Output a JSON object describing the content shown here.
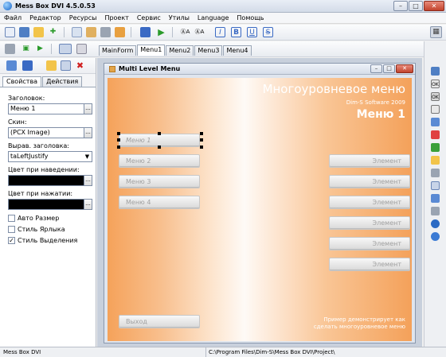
{
  "window": {
    "title": "Mess Box DVI 4.5.0.53"
  },
  "menu": [
    "Файл",
    "Редактор",
    "Ресурсы",
    "Проект",
    "Сервис",
    "Утилы",
    "Language",
    "Помощь"
  ],
  "doc_tabs": [
    "MainForm",
    "Menu1",
    "Menu2",
    "Menu3",
    "Menu4"
  ],
  "active_tab": "Menu1",
  "inspector": {
    "tabs": [
      "Свойства",
      "Действия"
    ],
    "caption_label": "Заголовок:",
    "caption_value": "Меню 1",
    "skin_label": "Скин:",
    "skin_value": "(PCX Image)",
    "align_label": "Вырав. заголовка:",
    "align_value": "taLeftJustify",
    "hover_color_label": "Цвет при наведении:",
    "press_color_label": "Цвет при нажатии:",
    "dots": "...",
    "checkboxes": [
      {
        "label": "Авто Размер",
        "checked": false
      },
      {
        "label": "Стиль Ярлыка",
        "checked": false
      },
      {
        "label": "Стиль Выделения",
        "checked": true
      }
    ]
  },
  "form_window": {
    "title": "Multi Level Menu",
    "heading": "Многоуровневое меню",
    "subheading": "Dim-S Software 2009",
    "menu_title": "Меню 1",
    "left_buttons": [
      "Меню 1",
      "Меню 2",
      "Меню 3",
      "Меню 4"
    ],
    "right_buttons": [
      "Элемент",
      "Элемент",
      "Элемент",
      "Элемент",
      "Элемент",
      "Элемент"
    ],
    "exit_button": "Выход",
    "note_line1": "Пример демонстрирует как",
    "note_line2": "сделать многоуровневое меню"
  },
  "status": {
    "left": "Mess Box DVI",
    "path": "C:\\Program Files\\Dim-S\\Mess Box DVI\\Project\\"
  },
  "colors": {
    "accent_orange": "#f4a15a",
    "hover_color": "#000000",
    "press_color": "#000000"
  },
  "icons": [
    "app-icon",
    "new-icon",
    "save-icon",
    "open-icon",
    "add-icon",
    "play-icon",
    "stop-icon",
    "delete-icon"
  ]
}
